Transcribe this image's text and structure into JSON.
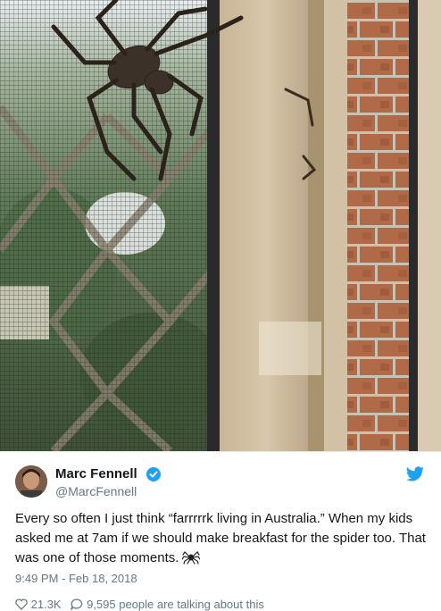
{
  "photo": {
    "alt_icon": "huntsman-spider-photo"
  },
  "tweet": {
    "author_name": "Marc Fennell",
    "author_handle": "@MarcFennell",
    "text": "Every so often I just think “farrrrrk living in Australia.” When my kids asked me at 7am if we should make breakfast for the spider too. That was one of those moments.",
    "emoji": "spider",
    "timestamp": "9:49 PM - Feb 18, 2018",
    "likes": "21.3K",
    "talking": "9,595 people are talking about this"
  },
  "colors": {
    "brand": "#1da1f2",
    "text": "#14171a",
    "muted": "#657786"
  }
}
